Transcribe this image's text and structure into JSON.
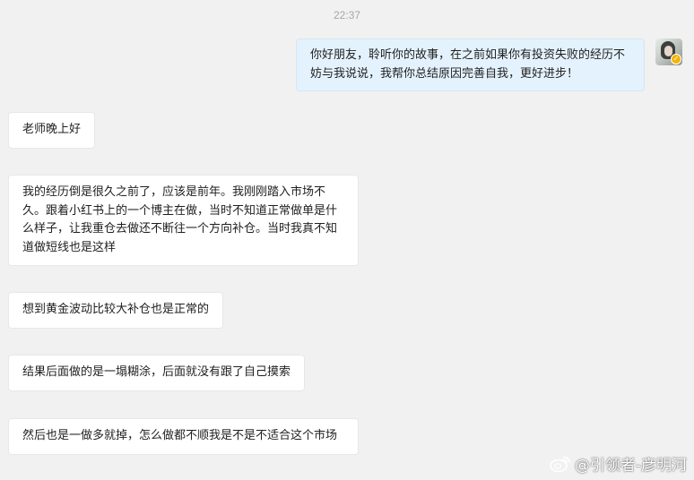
{
  "chat": {
    "timestamp": "22:37",
    "messages": [
      {
        "sender": "me",
        "text": "你好朋友，聆听你的故事，在之前如果你有投资失败的经历不妨与我说说，我帮你总结原因完善自我，更好进步！"
      },
      {
        "sender": "other",
        "text": "老师晚上好"
      },
      {
        "sender": "other",
        "text": "我的经历倒是很久之前了，应该是前年。我刚刚踏入市场不久。跟着小红书上的一个博主在做，当时不知道正常做单是什么样子，让我重仓去做还不断往一个方向补仓。当时我真不知道做短线也是这样"
      },
      {
        "sender": "other",
        "text": "想到黄金波动比较大补仓也是正常的"
      },
      {
        "sender": "other",
        "text": "结果后面做的是一塌糊涂，后面就没有跟了自己摸索"
      },
      {
        "sender": "other",
        "text": "然后也是一做多就掉，怎么做都不顺我是不是不适合这个市场"
      }
    ]
  },
  "watermark": {
    "text": "@引领者-彦明河",
    "icon": "weibo-icon"
  },
  "avatar": {
    "badge_icon": "vip-badge-icon"
  }
}
